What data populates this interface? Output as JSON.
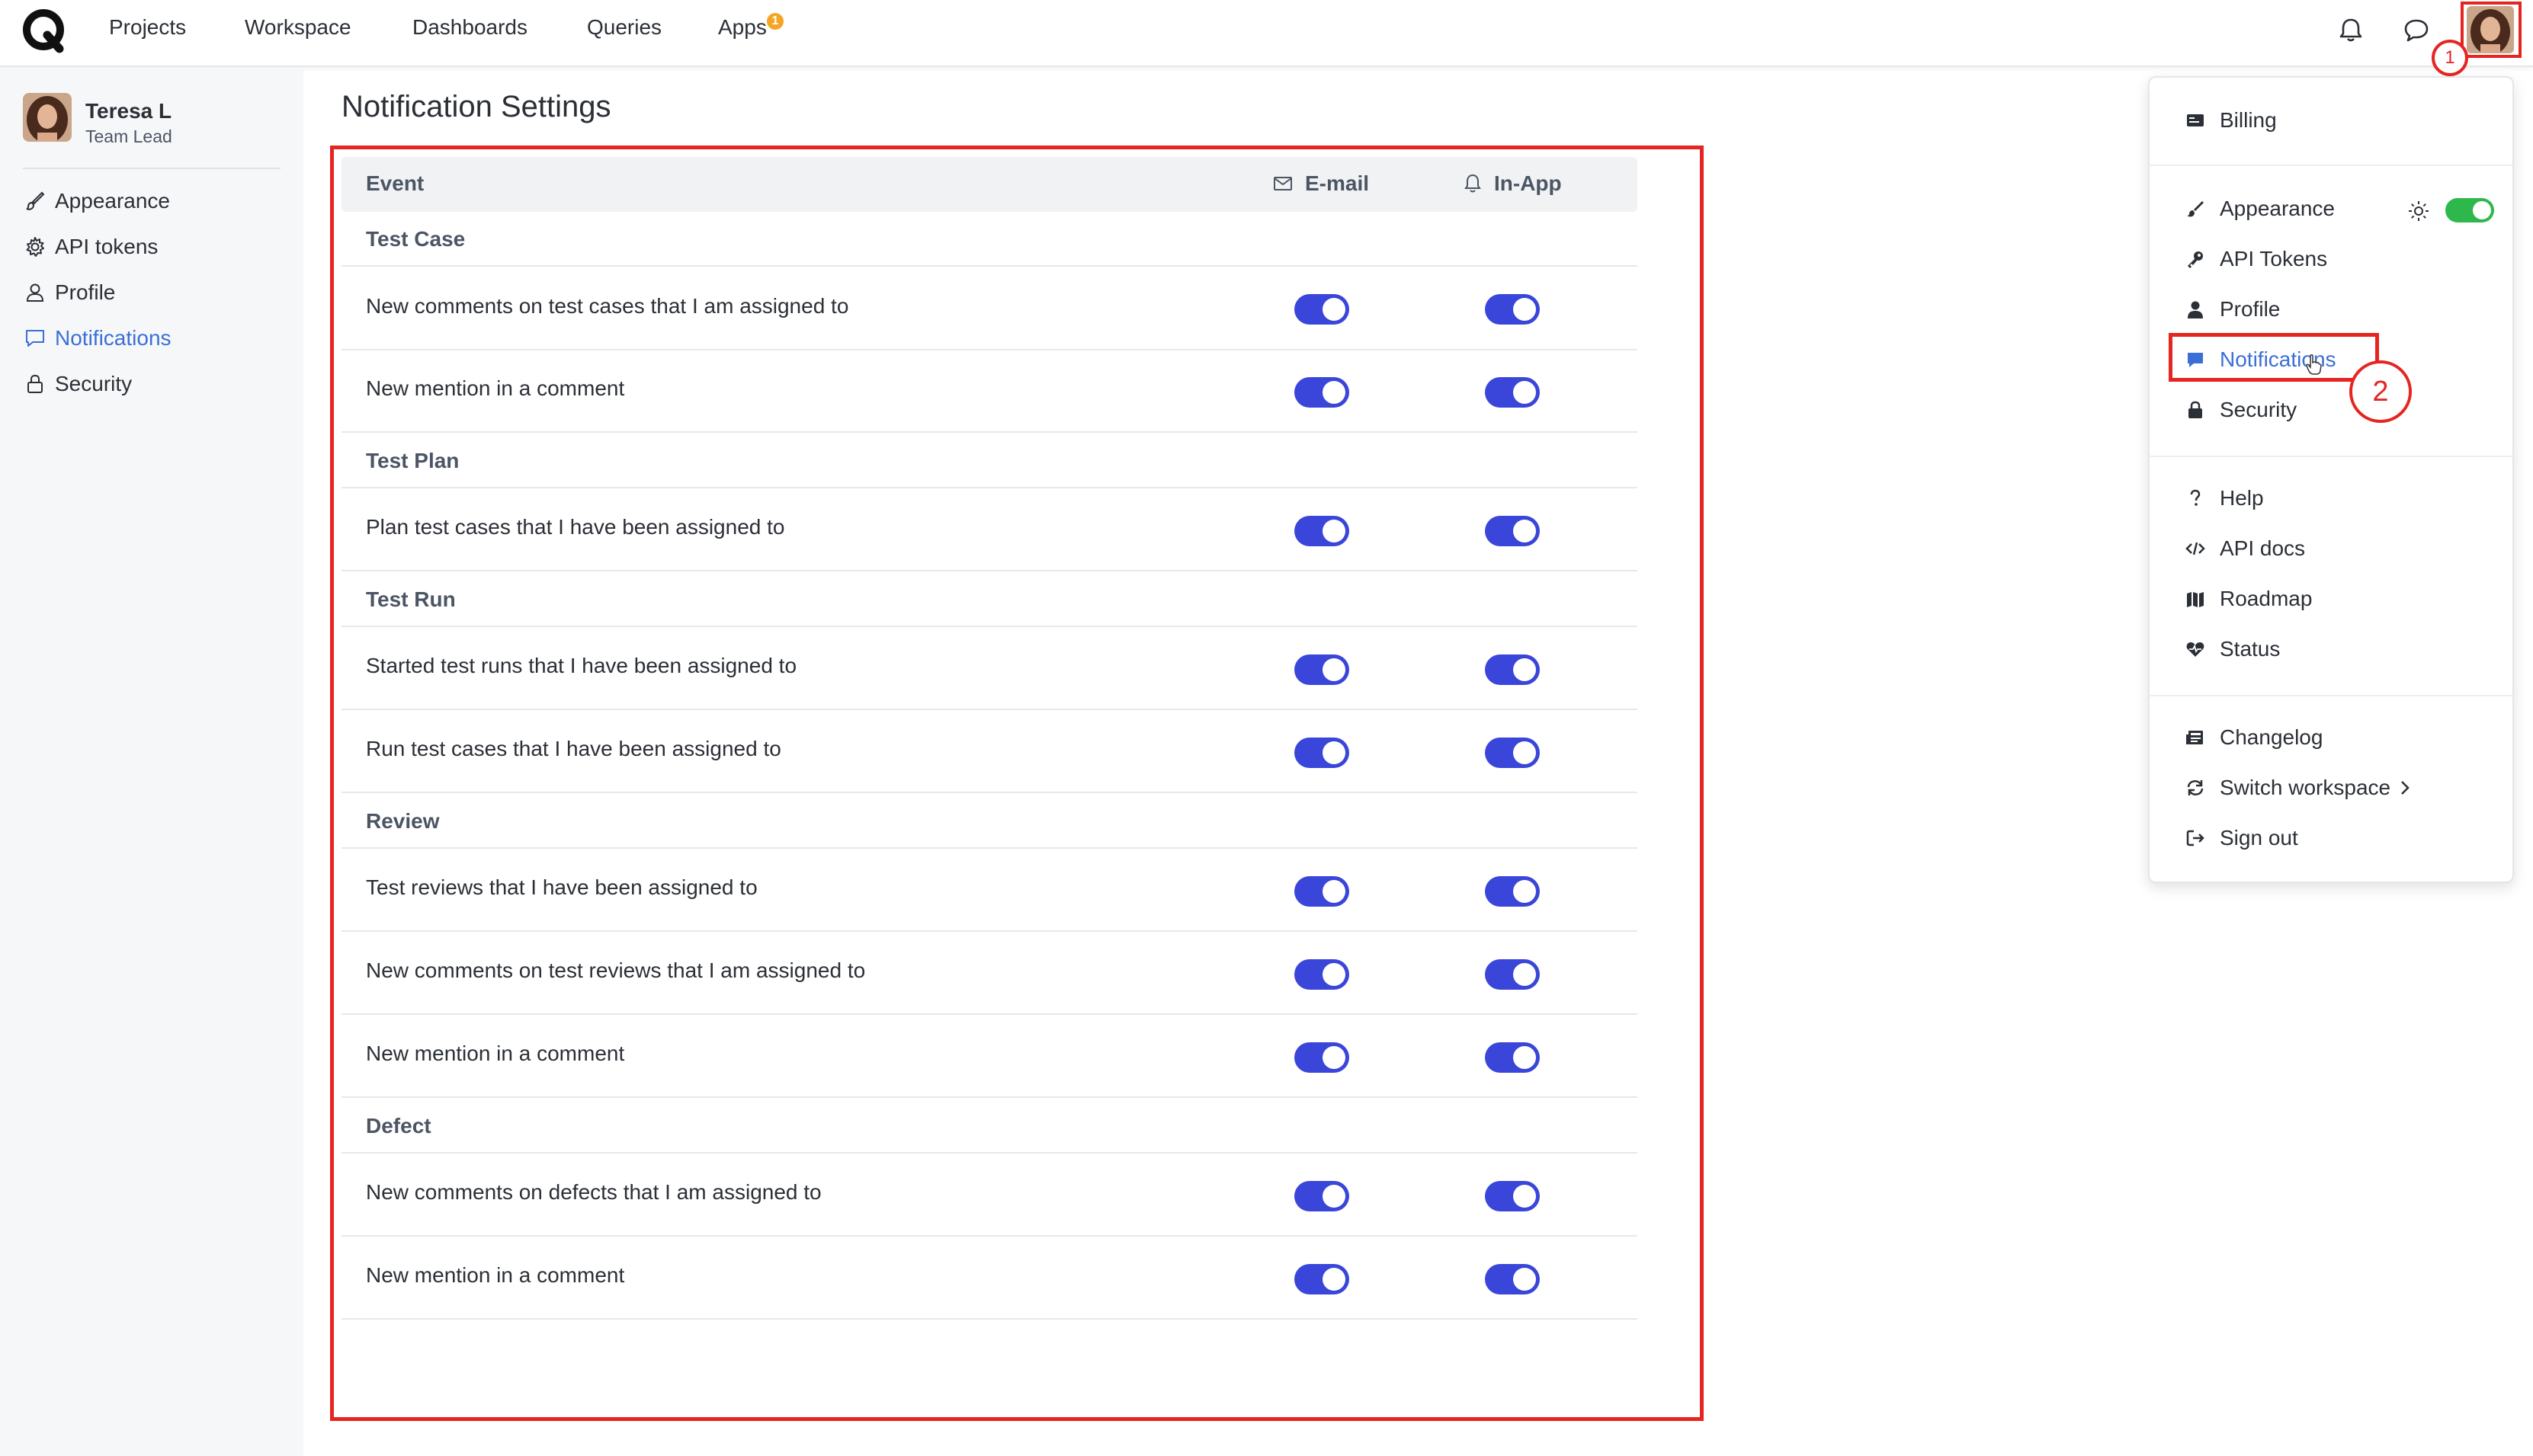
{
  "nav": {
    "items": [
      "Projects",
      "Workspace",
      "Dashboards",
      "Queries",
      "Apps"
    ],
    "apps_badge": "1"
  },
  "markers": {
    "first": "1",
    "second": "2"
  },
  "user": {
    "name": "Teresa L",
    "role": "Team Lead"
  },
  "sidebar": {
    "items": [
      {
        "label": "Appearance",
        "icon": "brush-icon"
      },
      {
        "label": "API tokens",
        "icon": "gear-icon"
      },
      {
        "label": "Profile",
        "icon": "user-icon"
      },
      {
        "label": "Notifications",
        "icon": "chat-icon",
        "active": true
      },
      {
        "label": "Security",
        "icon": "lock-icon"
      }
    ]
  },
  "page": {
    "title": "Notification Settings"
  },
  "table": {
    "headers": {
      "event": "Event",
      "email": "E-mail",
      "inapp": "In-App"
    },
    "groups": [
      {
        "name": "Test Case",
        "rows": [
          {
            "label": "New comments on test cases that I am assigned to",
            "email": true,
            "inapp": true
          },
          {
            "label": "New mention in a comment",
            "email": true,
            "inapp": true
          }
        ]
      },
      {
        "name": "Test Plan",
        "rows": [
          {
            "label": "Plan test cases that I have been assigned to",
            "email": true,
            "inapp": true
          }
        ]
      },
      {
        "name": "Test Run",
        "rows": [
          {
            "label": "Started test runs that I have been assigned to",
            "email": true,
            "inapp": true
          },
          {
            "label": "Run test cases that I have been assigned to",
            "email": true,
            "inapp": true
          }
        ]
      },
      {
        "name": "Review",
        "rows": [
          {
            "label": "Test reviews that I have been assigned to",
            "email": true,
            "inapp": true
          },
          {
            "label": "New comments on test reviews that I am assigned to",
            "email": true,
            "inapp": true
          },
          {
            "label": "New mention in a comment",
            "email": true,
            "inapp": true
          }
        ]
      },
      {
        "name": "Defect",
        "rows": [
          {
            "label": "New comments on defects that I am assigned to",
            "email": true,
            "inapp": true
          },
          {
            "label": "New mention in a comment",
            "email": true,
            "inapp": true
          }
        ]
      }
    ]
  },
  "dropdown": {
    "billing": "Billing",
    "appearance": "Appearance",
    "api_tokens": "API Tokens",
    "profile": "Profile",
    "notifications": "Notifications",
    "security": "Security",
    "help": "Help",
    "api_docs": "API docs",
    "roadmap": "Roadmap",
    "status": "Status",
    "changelog": "Changelog",
    "switch_workspace": "Switch workspace",
    "sign_out": "Sign out",
    "theme_toggle_on": true
  },
  "colors": {
    "accent": "#3a45d9",
    "link": "#3b6fd6",
    "annotation": "#e52521",
    "toggle_green": "#2eb84c"
  }
}
